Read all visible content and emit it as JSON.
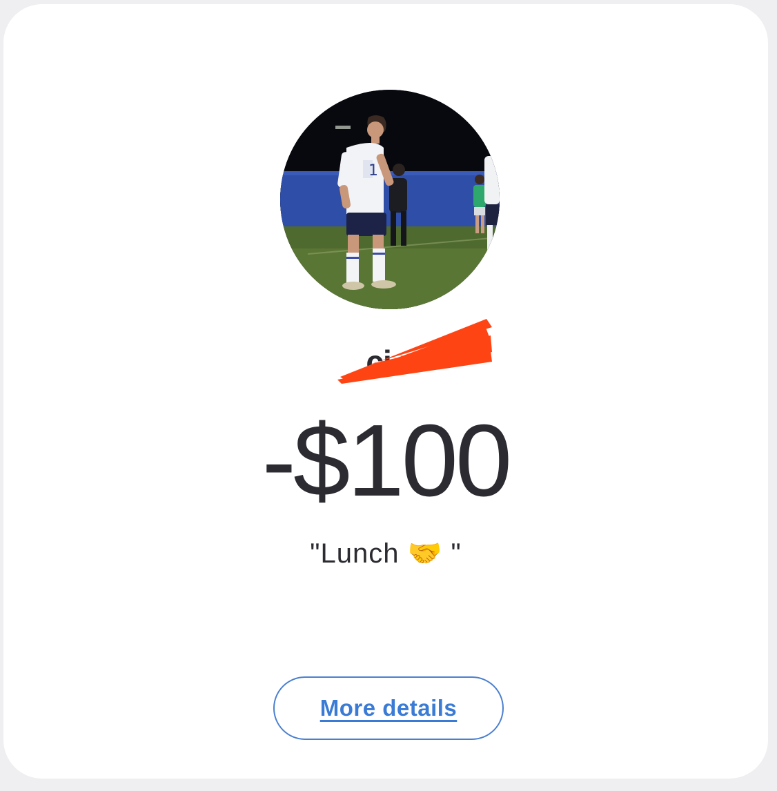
{
  "profile": {
    "name": "ci                    n",
    "avatar_icon": "profile-photo-soccer-player",
    "redaction_color": "#ff4414"
  },
  "transaction": {
    "amount": "-$100",
    "note": "\"Lunch 🤝 \""
  },
  "actions": {
    "more_details_label": "More details"
  },
  "colors": {
    "text": "#2b2b31",
    "link": "#3a7bd5",
    "button_border": "#4a7fd0",
    "background": "#efeff1",
    "card": "#ffffff"
  }
}
